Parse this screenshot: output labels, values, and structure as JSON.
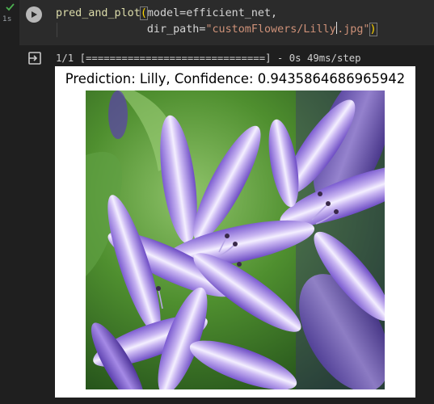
{
  "execution": {
    "status_icon": "check-icon",
    "duration": "1s"
  },
  "cell": {
    "run_icon": "play-icon",
    "code_line1_fn": "pred_and_plot",
    "code_line1_rest": "model=efficient_net,",
    "code_line2_key": "dir_path=",
    "code_line2_str_a": "\"customFlowers/Lilly",
    "code_line2_str_b": ".jpg\"",
    "open_paren": "(",
    "close_paren": ")"
  },
  "output": {
    "output_icon": "output-redirect-icon",
    "progress_text": "1/1 [==============================] - 0s 49ms/step",
    "figure_title": "Prediction: Lilly, Confidence: 0.9435864686965942",
    "image_subject": "purple-agapanthus-flower-photo"
  },
  "colors": {
    "background": "#1f1f1f",
    "cell_background": "#2b2b2b",
    "function": "#dcdcaa",
    "string": "#ce9178",
    "bracket": "#ffd700",
    "success": "#4caf50"
  }
}
